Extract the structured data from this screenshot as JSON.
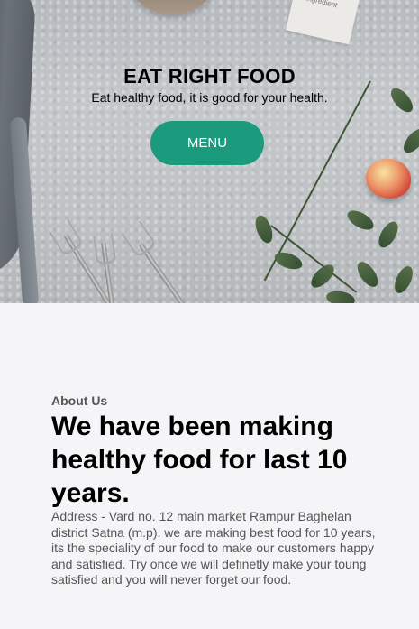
{
  "hero": {
    "title": "EAT RIGHT FOOD",
    "subtitle": "Eat healthy food, it is good for your health.",
    "menu_label": "MENU",
    "paper_text": "Ingredient"
  },
  "about": {
    "label": "About Us",
    "heading": "We have been making healthy food for last 10 years.",
    "text": "Address - Vard no. 12 main market Rampur Baghelan district Satna (m.p). we are making best food for 10 years, its the speciality of our food to make our customers happy and satisfied. Try once we will definetly make your toung satisfied and you will never forget our food."
  },
  "colors": {
    "accent": "#1c9a7e",
    "background": "#f5f5f7",
    "text": "#000000",
    "muted_text": "#555555"
  }
}
